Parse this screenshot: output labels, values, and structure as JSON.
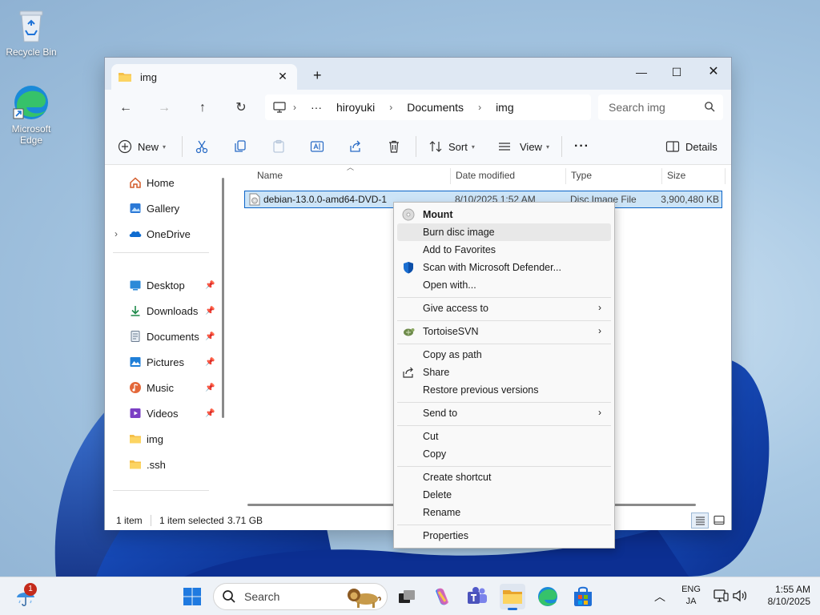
{
  "desktop": {
    "icons": [
      {
        "label": "Recycle Bin"
      },
      {
        "label": "Microsoft Edge"
      }
    ]
  },
  "window": {
    "tab_title": "img",
    "breadcrumb": [
      "hiroyuki",
      "Documents",
      "img"
    ],
    "breadcrumb_overflow": "···",
    "search_placeholder": "Search img"
  },
  "toolbar": {
    "new_label": "New",
    "sort_label": "Sort",
    "view_label": "View",
    "more_label": "···",
    "details_label": "Details"
  },
  "nav_pane": {
    "top": [
      "Home",
      "Gallery",
      "OneDrive"
    ],
    "quick": [
      "Desktop",
      "Downloads",
      "Documents",
      "Pictures",
      "Music",
      "Videos",
      "img",
      ".ssh"
    ]
  },
  "columns": [
    "Name",
    "Date modified",
    "Type",
    "Size"
  ],
  "files": [
    {
      "name": "debian-13.0.0-amd64-DVD-1",
      "date": "8/10/2025 1:52 AM",
      "type": "Disc Image File",
      "size": "3,900,480 KB"
    }
  ],
  "status": {
    "count": "1 item",
    "selected": "1 item selected",
    "size": "3.71 GB"
  },
  "context_menu": {
    "items": [
      {
        "label": "Mount"
      },
      {
        "label": "Burn disc image"
      },
      {
        "label": "Add to Favorites"
      },
      {
        "label": "Scan with Microsoft Defender..."
      },
      {
        "label": "Open with..."
      },
      {
        "label": "Give access to"
      },
      {
        "label": "TortoiseSVN"
      },
      {
        "label": "Copy as path"
      },
      {
        "label": "Share"
      },
      {
        "label": "Restore previous versions"
      },
      {
        "label": "Send to"
      },
      {
        "label": "Cut"
      },
      {
        "label": "Copy"
      },
      {
        "label": "Create shortcut"
      },
      {
        "label": "Delete"
      },
      {
        "label": "Rename"
      },
      {
        "label": "Properties"
      }
    ]
  },
  "taskbar": {
    "search_label": "Search",
    "weather_badge": "1",
    "lang_line1": "ENG",
    "lang_line2": "JA",
    "time": "1:55 AM",
    "date": "8/10/2025"
  }
}
